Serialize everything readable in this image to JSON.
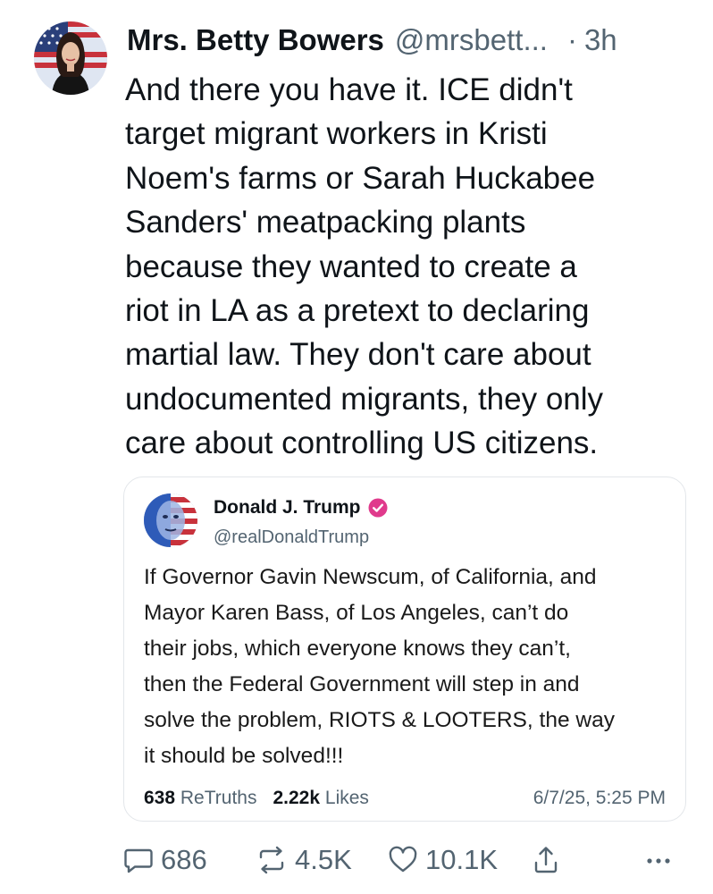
{
  "post": {
    "display_name": "Mrs. Betty Bowers",
    "handle": "@mrsbett...",
    "separator": "·",
    "time": "3h",
    "text": "And there you have it. ICE didn't\ntarget migrant workers in Kristi\nNoem's farms or Sarah Huckabee\nSanders' meatpacking plants\nbecause they wanted to create a\nriot in LA as a pretext to declaring\nmartial law. They don't care about\nundocumented migrants, they only\ncare about controlling US citizens.",
    "avatar_icon": "profile-photo"
  },
  "quote": {
    "display_name": "Donald J. Trump",
    "handle": "@realDonaldTrump",
    "verified_icon": "verified-badge-icon",
    "verified_color": "#e03a8c",
    "text": "If Governor Gavin Newscum, of California, and\nMayor Karen Bass, of Los Angeles, can’t do\ntheir jobs, which everyone knows they can’t,\nthen the Federal Government will step in and\nsolve the problem, RIOTS & LOOTERS, the way\nit should be solved!!!",
    "retruths_count": "638",
    "retruths_label": "ReTruths",
    "likes_count": "2.22k",
    "likes_label": "Likes",
    "date": "6/7/25, 5:25 PM"
  },
  "actions": {
    "replies": "686",
    "reposts": "4.5K",
    "likes": "10.1K",
    "icons": [
      "reply-icon",
      "repost-icon",
      "like-icon",
      "share-icon",
      "more-icon"
    ]
  },
  "colors": {
    "text_primary": "#0f1419",
    "text_secondary": "#536471",
    "border": "#e3e6ea"
  }
}
